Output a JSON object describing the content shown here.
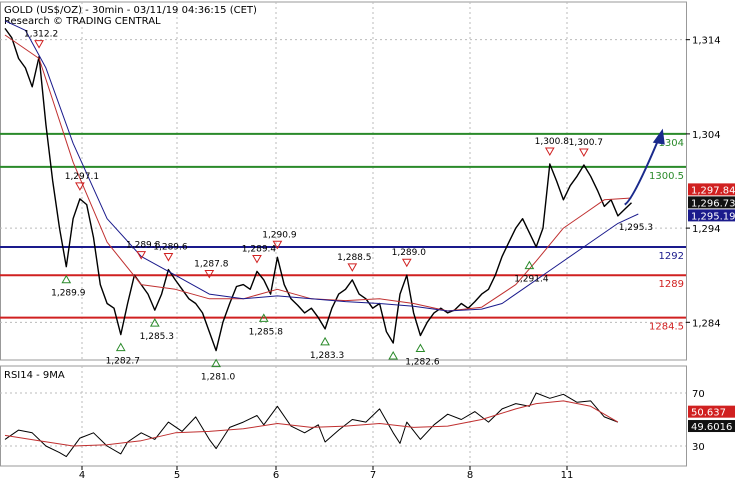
{
  "header": {
    "title": "GOLD (US$/OZ) - 30min - 03/11/19 04:36:15 (CET)",
    "subtitle": "Research © TRADING CENTRAL"
  },
  "colors": {
    "price": "#000000",
    "ma_fast": "#c03030",
    "ma_slow": "#1a1a8c",
    "support": "#2a8a2a",
    "resistance": "#d02020",
    "pivot": "#1a1a8c",
    "arrow": "#1a2a8c",
    "grid": "#bbbbbb"
  },
  "chart_data": [
    {
      "type": "line",
      "panel": "price",
      "x_ticks": [
        "4",
        "5",
        "6",
        "7",
        "8",
        "11"
      ],
      "y_ticks": [
        1284,
        1294,
        1304,
        1314
      ],
      "ylim": [
        1280.0,
        1318.0
      ],
      "x_range": [
        0,
        100
      ],
      "series": [
        {
          "name": "",
          "style": "price",
          "x": [
            0,
            1,
            2,
            3,
            4,
            5,
            6,
            7,
            8,
            9,
            10,
            11,
            12,
            13,
            14,
            15,
            16,
            17,
            18,
            19,
            20,
            21,
            22,
            23,
            24,
            25,
            26,
            27,
            28,
            29,
            30,
            31,
            32,
            33,
            34,
            35,
            36,
            37,
            38,
            39,
            40,
            41,
            42,
            43,
            44,
            45,
            46,
            47,
            48,
            49,
            50,
            51,
            52,
            53,
            54,
            55,
            56,
            57,
            58,
            59,
            60,
            61,
            62,
            63,
            64,
            65,
            66,
            67,
            68,
            69,
            70,
            71,
            72,
            73,
            74,
            75,
            76,
            77,
            78,
            79,
            80,
            81,
            82,
            83,
            84,
            85,
            86,
            87,
            88,
            89,
            90,
            91,
            92,
            93,
            94,
            95,
            96,
            97,
            98
          ],
          "y": [
            1315.2,
            1314.2,
            1312.0,
            1311.0,
            1309.0,
            1312.2,
            1305.0,
            1299.0,
            1294.0,
            1289.9,
            1295.0,
            1297.1,
            1296.5,
            1293.0,
            1288.0,
            1286.0,
            1285.5,
            1282.7,
            1286.0,
            1289.0,
            1288.0,
            1287.0,
            1285.3,
            1287.0,
            1289.6,
            1288.5,
            1287.5,
            1286.5,
            1286.0,
            1285.0,
            1283.0,
            1281.0,
            1284.0,
            1286.0,
            1287.8,
            1288.0,
            1287.5,
            1289.4,
            1288.5,
            1287.0,
            1290.9,
            1288.0,
            1286.5,
            1285.8,
            1285.0,
            1285.5,
            1284.5,
            1283.3,
            1285.5,
            1287.0,
            1287.5,
            1288.5,
            1287.0,
            1286.5,
            1285.5,
            1286.0,
            1283.0,
            1281.8,
            1287.0,
            1289.0,
            1285.0,
            1282.6,
            1284.0,
            1285.0,
            1285.5,
            1285.0,
            1285.3,
            1286.0,
            1285.5,
            1286.2,
            1287.0,
            1287.5,
            1289.0,
            1291.0,
            1292.5,
            1294.0,
            1295.0,
            1293.5,
            1292.0,
            1294.0,
            1300.8,
            1299.0,
            1297.0,
            1298.5,
            1299.5,
            1300.7,
            1299.5,
            1298.0,
            1296.3,
            1297.0,
            1295.3,
            1296.0,
            1296.7,
            null,
            null,
            null,
            null,
            null,
            null
          ]
        },
        {
          "name": "",
          "style": "ma_fast",
          "x": [
            0,
            5,
            10,
            15,
            20,
            25,
            30,
            35,
            40,
            45,
            50,
            55,
            60,
            65,
            70,
            75,
            78,
            82,
            85,
            88,
            92
          ],
          "y": [
            1314.5,
            1312.0,
            1301.0,
            1292.5,
            1288.0,
            1287.5,
            1286.5,
            1286.5,
            1287.5,
            1286.5,
            1286.3,
            1286.5,
            1286.0,
            1285.2,
            1285.6,
            1288.0,
            1290.5,
            1294.0,
            1295.5,
            1297.0,
            1297.2
          ]
        },
        {
          "name": "",
          "style": "ma_slow",
          "x": [
            0,
            3,
            6,
            10,
            15,
            20,
            25,
            30,
            35,
            40,
            45,
            50,
            55,
            60,
            65,
            70,
            73,
            76,
            80,
            85,
            90,
            93
          ],
          "y": [
            1316.0,
            1315.0,
            1311.0,
            1303.0,
            1295.0,
            1291.0,
            1289.0,
            1287.0,
            1286.5,
            1286.8,
            1286.5,
            1286.2,
            1286.0,
            1285.7,
            1285.2,
            1285.4,
            1286.0,
            1287.5,
            1289.5,
            1292.0,
            1294.5,
            1295.5
          ]
        }
      ],
      "levels": [
        {
          "value": 1304,
          "label": "1304",
          "kind": "support"
        },
        {
          "value": 1300.5,
          "label": "1300.5",
          "kind": "support"
        },
        {
          "value": 1292,
          "label": "1292",
          "kind": "pivot"
        },
        {
          "value": 1289,
          "label": "1289",
          "kind": "resistance"
        },
        {
          "value": 1284.5,
          "label": "1284.5",
          "kind": "resistance"
        }
      ],
      "price_tags": [
        {
          "value": 1297.84,
          "label": "1,297.84",
          "kind": "resistance"
        },
        {
          "value": 1296.73,
          "label": "1,296.73",
          "kind": "price"
        },
        {
          "value": 1295.19,
          "label": "1,295.19",
          "kind": "pivot"
        }
      ],
      "markers": [
        {
          "x": 5,
          "value": 1312.2,
          "label": "1,312.2",
          "dir": "down"
        },
        {
          "x": 11,
          "value": 1297.1,
          "label": "1,297.1",
          "dir": "down"
        },
        {
          "x": 9,
          "value": 1289.9,
          "label": "1,289.9",
          "dir": "up"
        },
        {
          "x": 20,
          "value": 1289.8,
          "label": "1,289.8",
          "dir": "down"
        },
        {
          "x": 17,
          "value": 1282.7,
          "label": "1,282.7",
          "dir": "up"
        },
        {
          "x": 24,
          "value": 1289.6,
          "label": "1,289.6",
          "dir": "down"
        },
        {
          "x": 22,
          "value": 1285.3,
          "label": "1,285.3",
          "dir": "up"
        },
        {
          "x": 30,
          "value": 1287.8,
          "label": "1,287.8",
          "dir": "down"
        },
        {
          "x": 31,
          "value": 1281.0,
          "label": "1,281.0",
          "dir": "up"
        },
        {
          "x": 37,
          "value": 1289.4,
          "label": "1,289.4",
          "dir": "down"
        },
        {
          "x": 38,
          "value": 1285.8,
          "label": "1,285.8",
          "dir": "up"
        },
        {
          "x": 40,
          "value": 1290.9,
          "label": "1,290.9",
          "dir": "down"
        },
        {
          "x": 47,
          "value": 1283.3,
          "label": "1,283.3",
          "dir": "up"
        },
        {
          "x": 51,
          "value": 1288.5,
          "label": "1,288.5",
          "dir": "down"
        },
        {
          "x": 57,
          "value": 1281.8,
          "label": "",
          "dir": "up"
        },
        {
          "x": 59,
          "value": 1289.0,
          "label": "1,289.0",
          "dir": "down"
        },
        {
          "x": 61,
          "value": 1282.6,
          "label": "1,282.6",
          "dir": "up"
        },
        {
          "x": 80,
          "value": 1300.8,
          "label": "1,300.8",
          "dir": "down"
        },
        {
          "x": 77,
          "value": 1291.4,
          "label": "1,291.4",
          "dir": "up"
        },
        {
          "x": 85,
          "value": 1300.7,
          "label": "1,300.7",
          "dir": "down"
        },
        {
          "x": 90,
          "value": 1295.3,
          "label": "1,295.3",
          "dir": "none"
        }
      ],
      "forecast": {
        "from": [
          91,
          1296.5
        ],
        "to": [
          96,
          1303.5
        ]
      }
    },
    {
      "type": "line",
      "panel": "rsi",
      "title": "RSI14 - 9MA",
      "y_ticks": [
        30,
        70
      ],
      "ylim": [
        15,
        90
      ],
      "x_range": [
        0,
        100
      ],
      "series": [
        {
          "name": "",
          "style": "rsi",
          "x": [
            0,
            2,
            4,
            6,
            8,
            9,
            11,
            13,
            15,
            17,
            18,
            20,
            22,
            24,
            26,
            28,
            30,
            31,
            33,
            35,
            37,
            38,
            40,
            42,
            44,
            46,
            47,
            49,
            51,
            53,
            55,
            57,
            58,
            59,
            61,
            63,
            65,
            67,
            69,
            71,
            73,
            75,
            77,
            78,
            80,
            82,
            84,
            86,
            88,
            90
          ],
          "y": [
            35,
            42,
            40,
            30,
            25,
            22,
            36,
            40,
            30,
            24,
            33,
            40,
            35,
            48,
            41,
            52,
            35,
            28,
            44,
            48,
            53,
            46,
            60,
            45,
            40,
            46,
            33,
            42,
            50,
            48,
            58,
            40,
            32,
            48,
            35,
            46,
            54,
            50,
            56,
            48,
            58,
            62,
            60,
            70,
            66,
            69,
            63,
            64,
            52,
            48
          ]
        },
        {
          "name": "",
          "style": "rsi_ma",
          "x": [
            0,
            5,
            10,
            15,
            20,
            25,
            30,
            35,
            40,
            45,
            50,
            55,
            60,
            65,
            70,
            75,
            78,
            82,
            86,
            90
          ],
          "y": [
            38,
            34,
            30,
            31,
            34,
            40,
            41,
            43,
            47,
            44,
            45,
            47,
            44,
            45,
            50,
            58,
            62,
            64,
            60,
            48
          ]
        }
      ],
      "tags": [
        {
          "value": 50.637,
          "label": "50.637",
          "kind": "resistance"
        },
        {
          "value": 49.6016,
          "label": "49.6016",
          "kind": "price"
        }
      ]
    }
  ]
}
